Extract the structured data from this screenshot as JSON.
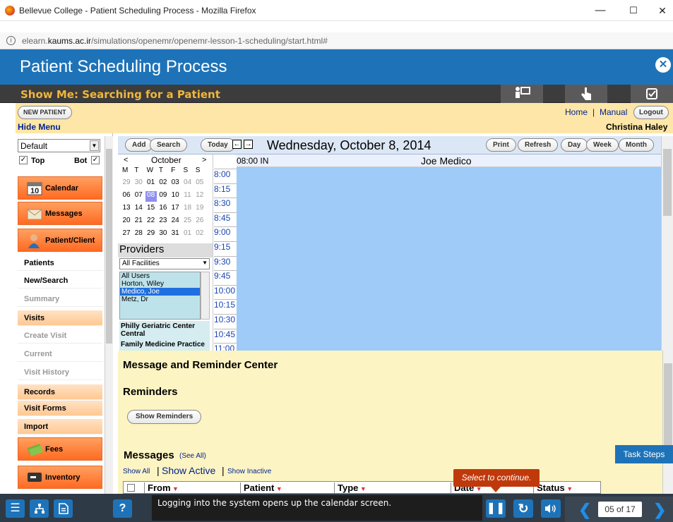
{
  "browser": {
    "title": "Bellevue College - Patient Scheduling Process - Mozilla Firefox",
    "url_prefix": "elearn.",
    "url_domain": "kaums.ac.ir",
    "url_path": "/simulations/openemr/openemr-lesson-1-scheduling/start.html#",
    "min": "—",
    "max": "☐",
    "close": "✕"
  },
  "course": {
    "title": "Patient Scheduling Process",
    "close": "✕",
    "subtitle": "Show Me: Searching for a Patient"
  },
  "oemr": {
    "new_patient": "NEW PATIENT",
    "hide_menu": "Hide Menu",
    "home": "Home",
    "sep": "|",
    "manual": "Manual",
    "logout": "Logout",
    "user": "Christina Haley",
    "menu": {
      "select": "Default",
      "top": "Top",
      "bot": "Bot",
      "items": [
        {
          "label": "Calendar",
          "type": "big"
        },
        {
          "label": "Messages",
          "type": "big"
        },
        {
          "label": "Patient/Client",
          "type": "big"
        },
        {
          "label": "Patients",
          "type": "plain"
        },
        {
          "label": "New/Search",
          "type": "plain"
        },
        {
          "label": "Summary",
          "type": "gray"
        },
        {
          "label": "Visits",
          "type": "orange"
        },
        {
          "label": "Create Visit",
          "type": "gray"
        },
        {
          "label": "Current",
          "type": "gray"
        },
        {
          "label": "Visit History",
          "type": "gray"
        },
        {
          "label": "Records",
          "type": "orange"
        },
        {
          "label": "Visit Forms",
          "type": "orange"
        },
        {
          "label": "Import",
          "type": "orange"
        },
        {
          "label": "Fees",
          "type": "big"
        },
        {
          "label": "Inventory",
          "type": "big"
        }
      ],
      "cal_icon_num": "10"
    },
    "calendar": {
      "add": "Add",
      "search": "Search",
      "today": "Today",
      "date": "Wednesday, October 8, 2014",
      "print": "Print",
      "refresh": "Refresh",
      "day": "Day",
      "week": "Week",
      "month": "Month",
      "prev": "<",
      "next": ">",
      "month_name": "October",
      "weekdays": [
        "M",
        "T",
        "W",
        "T",
        "F",
        "S",
        "S"
      ],
      "weeks": [
        [
          "29",
          "30",
          "01",
          "02",
          "03",
          "04",
          "05"
        ],
        [
          "06",
          "07",
          "08",
          "09",
          "10",
          "11",
          "12"
        ],
        [
          "13",
          "14",
          "15",
          "16",
          "17",
          "18",
          "19"
        ],
        [
          "20",
          "21",
          "22",
          "23",
          "24",
          "25",
          "26"
        ],
        [
          "27",
          "28",
          "29",
          "30",
          "31",
          "01",
          "02"
        ]
      ],
      "selected_day": "08",
      "providers_title": "Providers",
      "facility": "All Facilities",
      "providers": [
        "All Users",
        "Horton, Wiley",
        "Medico, Joe",
        "Metz, Dr"
      ],
      "selected_provider": "Medico, Joe",
      "facilities": [
        "Philly Geriatric Center Central",
        "Family Medicine Practice"
      ],
      "times": [
        "8:00",
        "8:15",
        "8:30",
        "8:45",
        "9:00",
        "9:15",
        "9:30",
        "9:45",
        "10:00",
        "10:15",
        "10:30",
        "10:45",
        "11:00"
      ],
      "slot_label": "08:00 IN",
      "provider_col": "Joe Medico"
    },
    "messages": {
      "title": "Message and Reminder Center",
      "reminders": "Reminders",
      "show_reminders": "Show Reminders",
      "messages": "Messages",
      "see_all": "(See All)",
      "show_all": "Show All",
      "show_active": "Show Active",
      "show_inactive": "Show Inactive",
      "cols": [
        "From",
        "Patient",
        "Type",
        "Date",
        "Status"
      ]
    }
  },
  "task_steps": "Task Steps",
  "tooltip": "Select to continue.",
  "caption": "Logging into the system opens up the calendar screen.",
  "page_counter": "05 of 17"
}
